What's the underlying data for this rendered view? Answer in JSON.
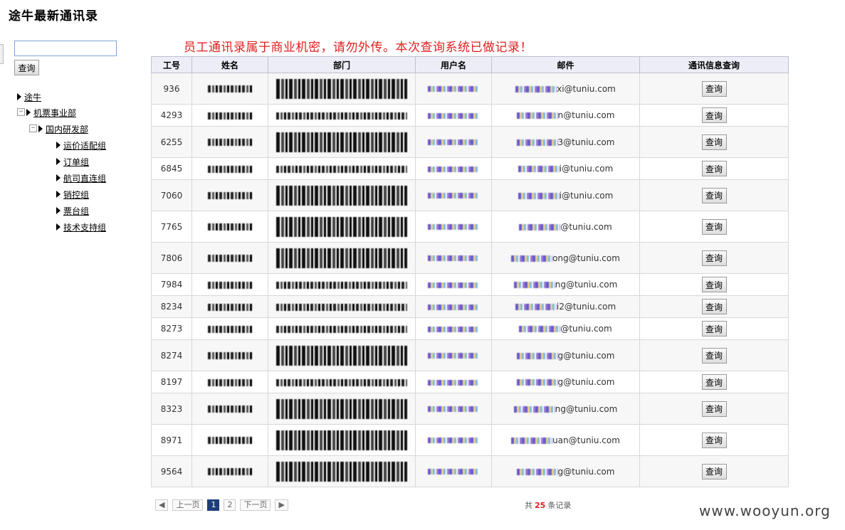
{
  "page": {
    "title": "途牛最新通讯录",
    "warning": "员工通讯录属于商业机密，请勿外传。本次查询系统已做记录！"
  },
  "search": {
    "value": "",
    "button_label": "查询"
  },
  "tree": {
    "root": "途牛",
    "division": "机票事业部",
    "department": "国内研发部",
    "groups": [
      "运价适配组",
      "订单组",
      "航司直连组",
      "销控组",
      "票台组",
      "技术支持组"
    ],
    "expanded_marker": "日"
  },
  "table": {
    "headers": [
      "工号",
      "姓名",
      "部门",
      "用户名",
      "邮件",
      "通讯信息查询"
    ],
    "button_label": "查询",
    "rows": [
      {
        "id": "936",
        "email_visible": "xi@tuniu.com",
        "dept_tall": true
      },
      {
        "id": "4293",
        "email_visible": "n@tuniu.com",
        "dept_tall": false
      },
      {
        "id": "6255",
        "email_visible": "3@tuniu.com",
        "dept_tall": true
      },
      {
        "id": "6845",
        "email_visible": "i@tuniu.com",
        "dept_tall": false
      },
      {
        "id": "7060",
        "email_visible": "i@tuniu.com",
        "dept_tall": true
      },
      {
        "id": "7765",
        "email_visible": "@tuniu.com",
        "dept_tall": true
      },
      {
        "id": "7806",
        "email_visible": "ong@tuniu.com",
        "dept_tall": true
      },
      {
        "id": "7984",
        "email_visible": "ng@tuniu.com",
        "dept_tall": false
      },
      {
        "id": "8234",
        "email_visible": "i2@tuniu.com",
        "dept_tall": false
      },
      {
        "id": "8273",
        "email_visible": "@tuniu.com",
        "dept_tall": false
      },
      {
        "id": "8274",
        "email_visible": "g@tuniu.com",
        "dept_tall": true
      },
      {
        "id": "8197",
        "email_visible": "g@tuniu.com",
        "dept_tall": false
      },
      {
        "id": "8323",
        "email_visible": "ng@tuniu.com",
        "dept_tall": true
      },
      {
        "id": "8971",
        "email_visible": "uan@tuniu.com",
        "dept_tall": true
      },
      {
        "id": "9564",
        "email_visible": "g@tuniu.com",
        "dept_tall": true
      }
    ]
  },
  "pager": {
    "prev": "上一页",
    "pages": [
      "1",
      "2"
    ],
    "next": "下一页",
    "count_prefix": "共",
    "count": "25",
    "count_suffix": "条记录"
  },
  "watermark": "www.wooyun.org"
}
